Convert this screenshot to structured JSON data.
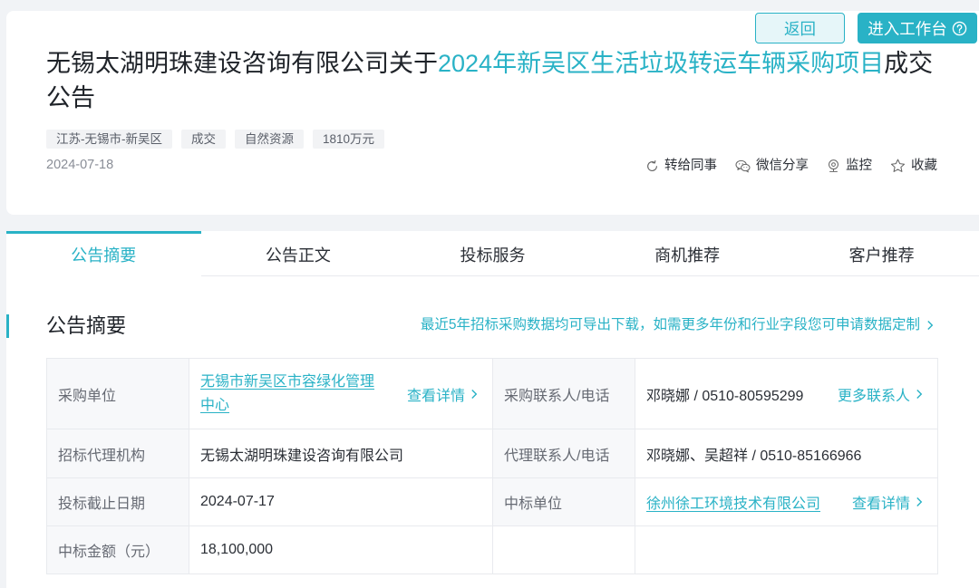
{
  "colors": {
    "accent": "#29b2c6",
    "accent_light_bg": "#e6f6f9",
    "page_bg": "#f1f3f6"
  },
  "header": {
    "back_label": "返回",
    "workbench_label": "进入工作台",
    "workbench_icon": "help-circle-icon",
    "title_prefix": "无锡太湖明珠建设咨询有限公司关于",
    "title_highlight": "2024年新吴区生活垃圾转运车辆采购项目",
    "title_suffix": "成交公告",
    "tags": [
      "江苏-无锡市-新吴区",
      "成交",
      "自然资源",
      "1810万元"
    ],
    "date": "2024-07-18",
    "actions": [
      {
        "label": "转给同事",
        "icon": "forward-icon"
      },
      {
        "label": "微信分享",
        "icon": "wechat-icon"
      },
      {
        "label": "监控",
        "icon": "monitor-icon"
      },
      {
        "label": "收藏",
        "icon": "star-icon"
      }
    ]
  },
  "tabs": [
    {
      "label": "公告摘要",
      "active": true
    },
    {
      "label": "公告正文",
      "active": false
    },
    {
      "label": "投标服务",
      "active": false
    },
    {
      "label": "商机推荐",
      "active": false
    },
    {
      "label": "客户推荐",
      "active": false
    }
  ],
  "summary": {
    "title": "公告摘要",
    "export_link": "最近5年招标采购数据均可导出下载，如需更多年份和行业字段您可申请数据定制",
    "rows": [
      {
        "label1": "采购单位",
        "value1": "无锡市新吴区市容绿化管理中心",
        "action1": "查看详情",
        "label2": "采购联系人/电话",
        "value2": "邓晓娜 / 0510-80595299",
        "action2": "更多联系人"
      },
      {
        "label1": "招标代理机构",
        "value1": "无锡太湖明珠建设咨询有限公司",
        "label2": "代理联系人/电话",
        "value2": "邓晓娜、吴超祥 / 0510-85166966"
      },
      {
        "label1": "投标截止日期",
        "value1": "2024-07-17",
        "label2": "中标单位",
        "value2": "徐州徐工环境技术有限公司",
        "action2": "查看详情"
      },
      {
        "label1": "中标金额（元）",
        "value1": "18,100,000"
      }
    ]
  }
}
